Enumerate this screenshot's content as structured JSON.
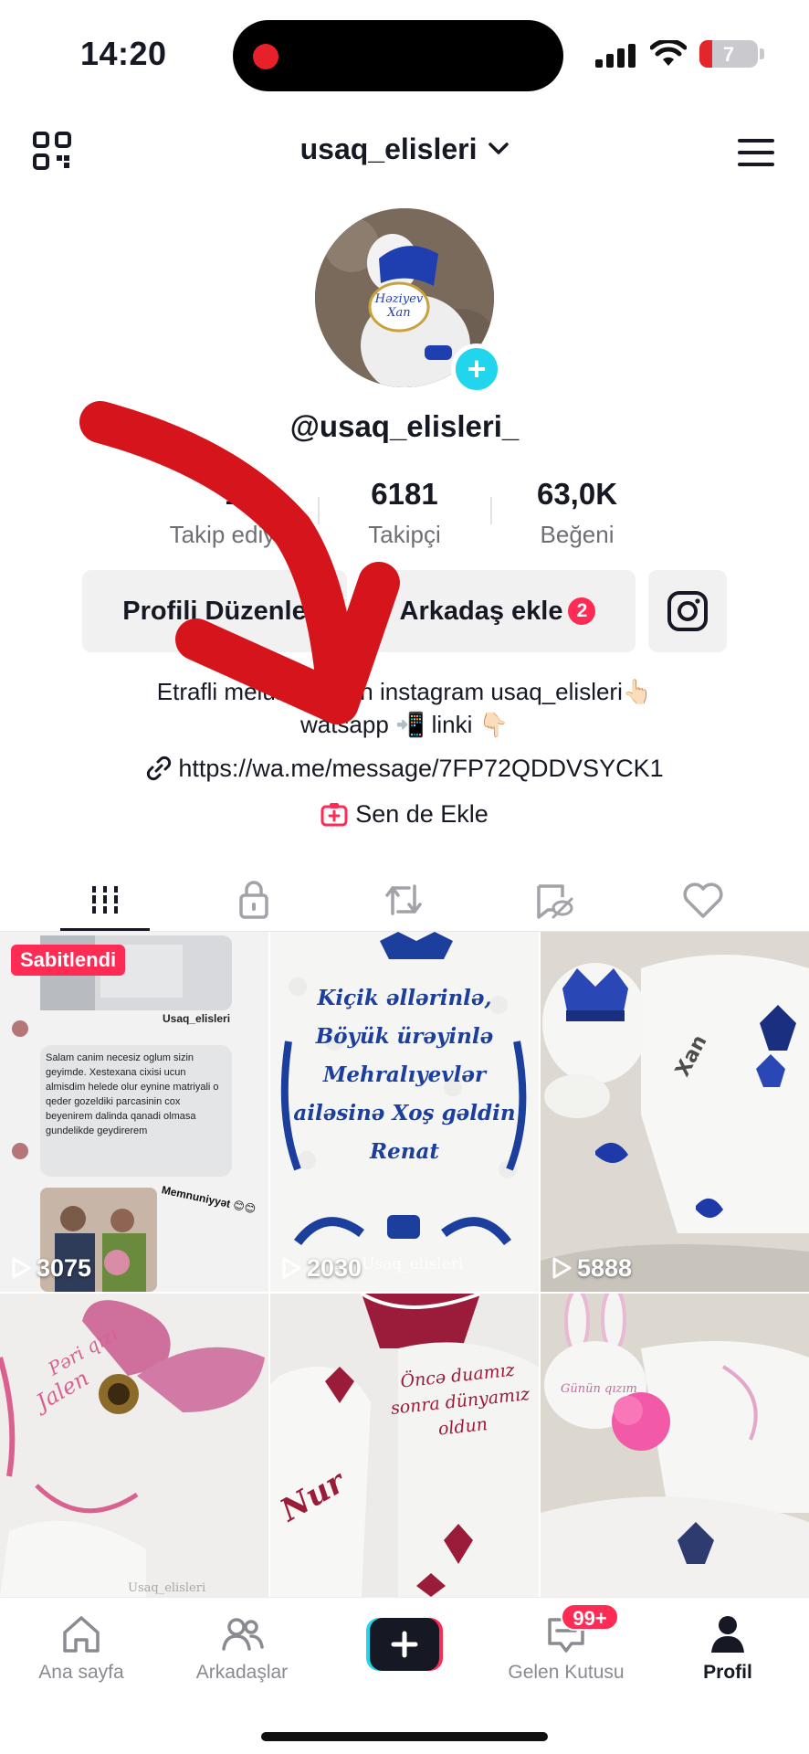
{
  "status_bar": {
    "time": "14:20",
    "battery": "7"
  },
  "header": {
    "username": "usaq_elisleri",
    "chevron": "⌄"
  },
  "profile": {
    "handle": "@usaq_elisleri_"
  },
  "stats": [
    {
      "value": "1",
      "label": "Takip ediyor"
    },
    {
      "value": "6181",
      "label": "Takipçi"
    },
    {
      "value": "63,0K",
      "label": "Beğeni"
    }
  ],
  "buttons": {
    "edit_profile": "Profili Düzenle",
    "add_friend": "Arkadaş ekle",
    "add_friend_badge": "2"
  },
  "bio": {
    "line1": "Etrafli melumat ucun instagram  usaq_elisleri👆🏻",
    "line2": "watsapp 📲 linki 👇🏻",
    "link": "https://wa.me/message/7FP72QDDVSYCK1",
    "add_link": "Sen de Ekle"
  },
  "grid": {
    "pinned_label": "Sabitlendi",
    "tiles": [
      {
        "views": "3075",
        "pinned": true
      },
      {
        "views": "2030",
        "overlay_text": "Kiçik əllərinlə, Böyük ürəyinlə Mehralıyevlər ailəsinə Xoş gəldin Renat",
        "watermark": "Usaq_elisleri"
      },
      {
        "views": "5888"
      },
      {
        "overlay_text": "Pəri qızı Jalen",
        "watermark": "Usaq_elisleri"
      },
      {
        "overlay_text": "Öncə duamız sonra dünyamız oldun",
        "name": "Nur"
      },
      {
        "overlay_text": "Günün qızım"
      }
    ],
    "pinned_post": {
      "account_label": "Usaq_elisleri",
      "message": "Salam canim necesiz oglum sizin geyimde. Xestexana cixisi ucun almisdim helede olur eynine matriyali o qeder gozeldiki parcasinin cox beyenirem dalinda qanadi olmasa gundelikde geydirerem",
      "sticker": "Memnuniyyət 😊😊"
    }
  },
  "bottom_nav": {
    "home": "Ana sayfa",
    "friends": "Arkadaşlar",
    "inbox": "Gelen Kutusu",
    "inbox_badge": "99+",
    "profile": "Profil"
  },
  "colors": {
    "brand_red": "#fe2c55",
    "brand_cyan": "#20d5ec",
    "arrow_red": "#d5141c"
  }
}
